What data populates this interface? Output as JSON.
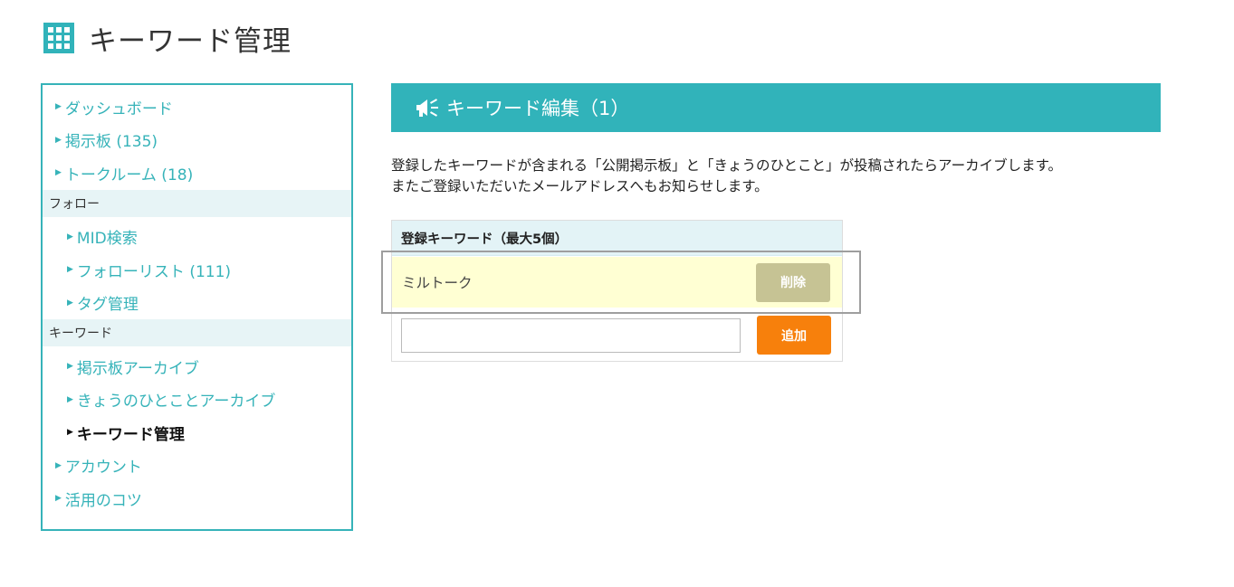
{
  "page": {
    "title": "キーワード管理",
    "header_icon": "grid-icon"
  },
  "sidebar": {
    "items": [
      {
        "label": "ダッシュボード"
      },
      {
        "label": "掲示板 (135)"
      },
      {
        "label": "トークルーム (18)"
      }
    ],
    "follow_section": {
      "label": "フォロー",
      "items": [
        {
          "label": "MID検索"
        },
        {
          "label": "フォローリスト (111)"
        },
        {
          "label": "タグ管理"
        }
      ]
    },
    "keyword_section": {
      "label": "キーワード",
      "items": [
        {
          "label": "掲示板アーカイブ"
        },
        {
          "label": "きょうのひとことアーカイブ"
        },
        {
          "label": "キーワード管理",
          "active": true
        }
      ]
    },
    "bottom_items": [
      {
        "label": "アカウント"
      },
      {
        "label": "活用のコツ"
      }
    ],
    "accent_color": "#36b3b9"
  },
  "main": {
    "banner_title": "キーワード編集（1）",
    "banner_icon": "megaphone-icon",
    "description_line1": "登録したキーワードが含まれる「公開掲示板」と「きょうのひとこと」が投稿されたらアーカイブします。",
    "description_line2": "またご登録いただいたメールアドレスへもお知らせします。",
    "keyword_box": {
      "header": "登録キーワード（最大5個）",
      "keywords": [
        {
          "text": "ミルトーク",
          "delete_label": "削除"
        }
      ],
      "input_value": "",
      "input_placeholder": "",
      "add_label": "追加"
    },
    "colors": {
      "banner": "#31b3ba",
      "add_button": "#f7800c",
      "delete_button": "#c6c394",
      "keyword_row": "#ffffd3"
    }
  }
}
